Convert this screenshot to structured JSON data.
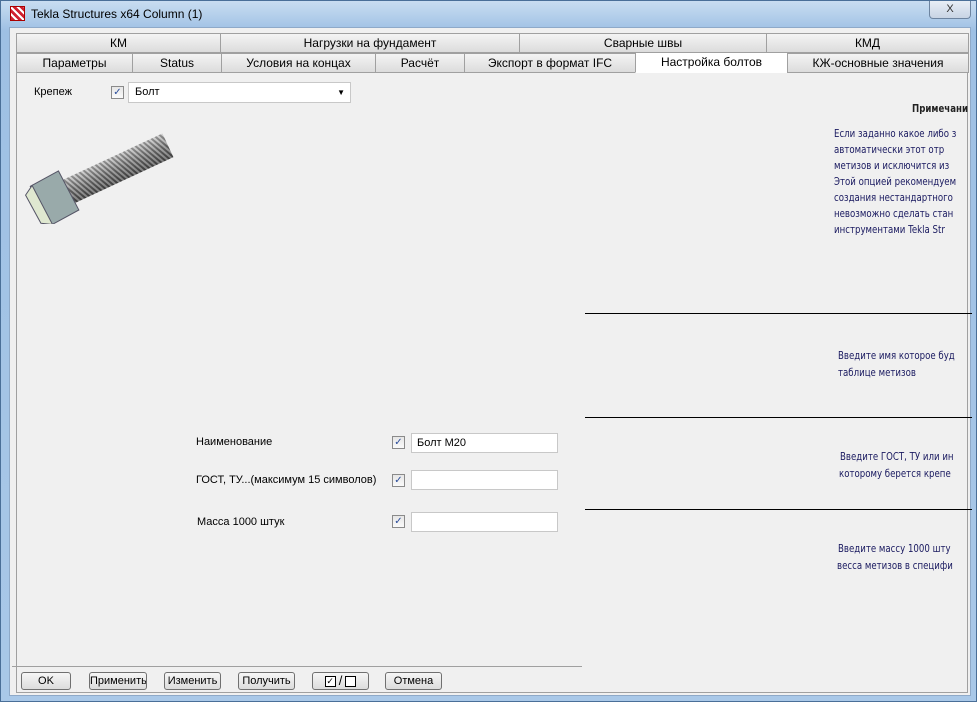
{
  "window": {
    "title": "Tekla Structures x64  Column (1)",
    "close_label": "X"
  },
  "tabs_row1": [
    "КМ",
    "Нагрузки на фундамент",
    "Сварные швы",
    "КМД"
  ],
  "tabs_row2": [
    "Параметры",
    "Status",
    "Условия на концах",
    "Расчёт",
    "Экспорт в формат IFC",
    "Настройка болтов",
    "КЖ-основные значения"
  ],
  "fastener": {
    "label": "Крепеж",
    "checked": true,
    "value": "Болт"
  },
  "fields": [
    {
      "label": "Наименование",
      "checked": true,
      "value": "Болт M20"
    },
    {
      "label": "ГОСТ, ТУ...(максимум 15 символов)",
      "checked": true,
      "value": ""
    },
    {
      "label": "Масса 1000 штук",
      "checked": true,
      "value": ""
    }
  ],
  "notes": {
    "title": "Примечани",
    "main": [
      "Если заданно какое либо з",
      "автоматически этот отр",
      "метизов и исключится из",
      "Этой опцией рекомендуем",
      "создания нестандартного",
      "невозможно сделать стан",
      "инструментами Tekla Str"
    ],
    "name": [
      "Введите имя которое буд",
      "таблице метизов"
    ],
    "gost": [
      "Введите ГОСТ, ТУ или ин",
      "которому берется крепе"
    ],
    "mass": [
      "Введите массу 1000 шту",
      "весса метизов в специфи"
    ]
  },
  "buttons": {
    "ok": "OK",
    "apply": "Применить",
    "modify": "Изменить",
    "get": "Получить",
    "toggle_check": "✓",
    "toggle_sep": "/",
    "cancel": "Отмена"
  }
}
